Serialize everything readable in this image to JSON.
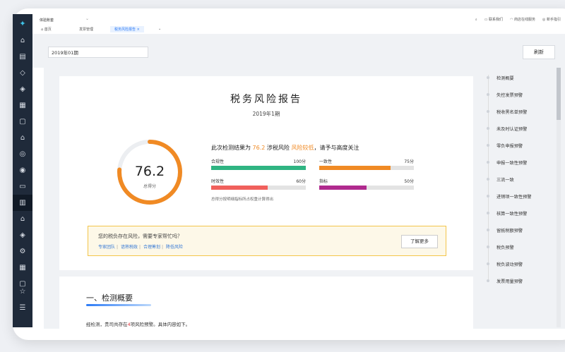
{
  "app": {
    "company": "体验账套",
    "logo_icon": "logo-icon"
  },
  "topbar": {
    "links": [
      {
        "icon": "message-icon",
        "glyph": "▭",
        "label": "联系我们"
      },
      {
        "icon": "headset-icon",
        "glyph": "◠",
        "label": "商店在线服务"
      },
      {
        "icon": "help-icon",
        "glyph": "◎",
        "label": "新手指引"
      }
    ]
  },
  "tabs": [
    {
      "label": "首页"
    },
    {
      "label": "发票管理"
    },
    {
      "label": "税务风险报告",
      "active": true
    }
  ],
  "toolbar": {
    "period_value": "2019年01期",
    "refresh_label": "刷新"
  },
  "report": {
    "title": "税务风险报告",
    "period": "2019年1期",
    "score": "76.2",
    "score_value": 76.2,
    "score_max": 100,
    "score_label": "总得分",
    "summary_prefix": "此次检测结果为",
    "summary_score": "76.2",
    "summary_mid": "涉税风险",
    "summary_level": "风险较低",
    "summary_suffix": "，请予与高度关注",
    "metrics": [
      {
        "name": "合规性",
        "score": "100分",
        "value": 100,
        "max": 100,
        "color": "#2fb482"
      },
      {
        "name": "一致性",
        "score": "75分",
        "value": 75,
        "max": 100,
        "color": "#f08a24"
      },
      {
        "name": "时效性",
        "score": "60分",
        "value": 60,
        "max": 100,
        "color": "#f0605c"
      },
      {
        "name": "指标",
        "score": "50分",
        "value": 50,
        "max": 100,
        "color": "#b02a8e"
      }
    ],
    "note": "总得分按明细指标所占权重计算得出",
    "banner": {
      "title": "您的税负存在风险，需要专家帮忙吗？",
      "links": [
        "专家团队",
        "谙熟税政",
        "合理筹划",
        "降低风险"
      ],
      "button": "了解更多"
    }
  },
  "section": {
    "title": "一、检测概要",
    "text_prefix": "经检测，贵司共存在",
    "count": "4",
    "text_suffix": "项风险预警。具体内容如下。"
  },
  "toc": [
    "检测概要",
    "失控发票预警",
    "税收黑名单预警",
    "未及时认证预警",
    "零负申报预警",
    "申报一致性预警",
    "三流一致",
    "进销项一致性预警",
    "核算一致性预警",
    "留抵税额预警",
    "税负预警",
    "税负波动预警",
    "发票用量预警"
  ],
  "colors": {
    "sidebar": "#1f2a3a",
    "accent": "#2e7cf6",
    "gauge": "#f08a24",
    "warning": "#f08a24"
  },
  "sidebar_icons": [
    "cart-icon",
    "invoice-icon",
    "diamond-icon",
    "tag-icon",
    "chart-icon",
    "bag-icon",
    "home-icon",
    "badge-icon",
    "coin-icon",
    "monitor-icon",
    "book-icon",
    "bank-icon",
    "layers-icon",
    "gear-icon",
    "grid-icon",
    "chat-icon"
  ]
}
